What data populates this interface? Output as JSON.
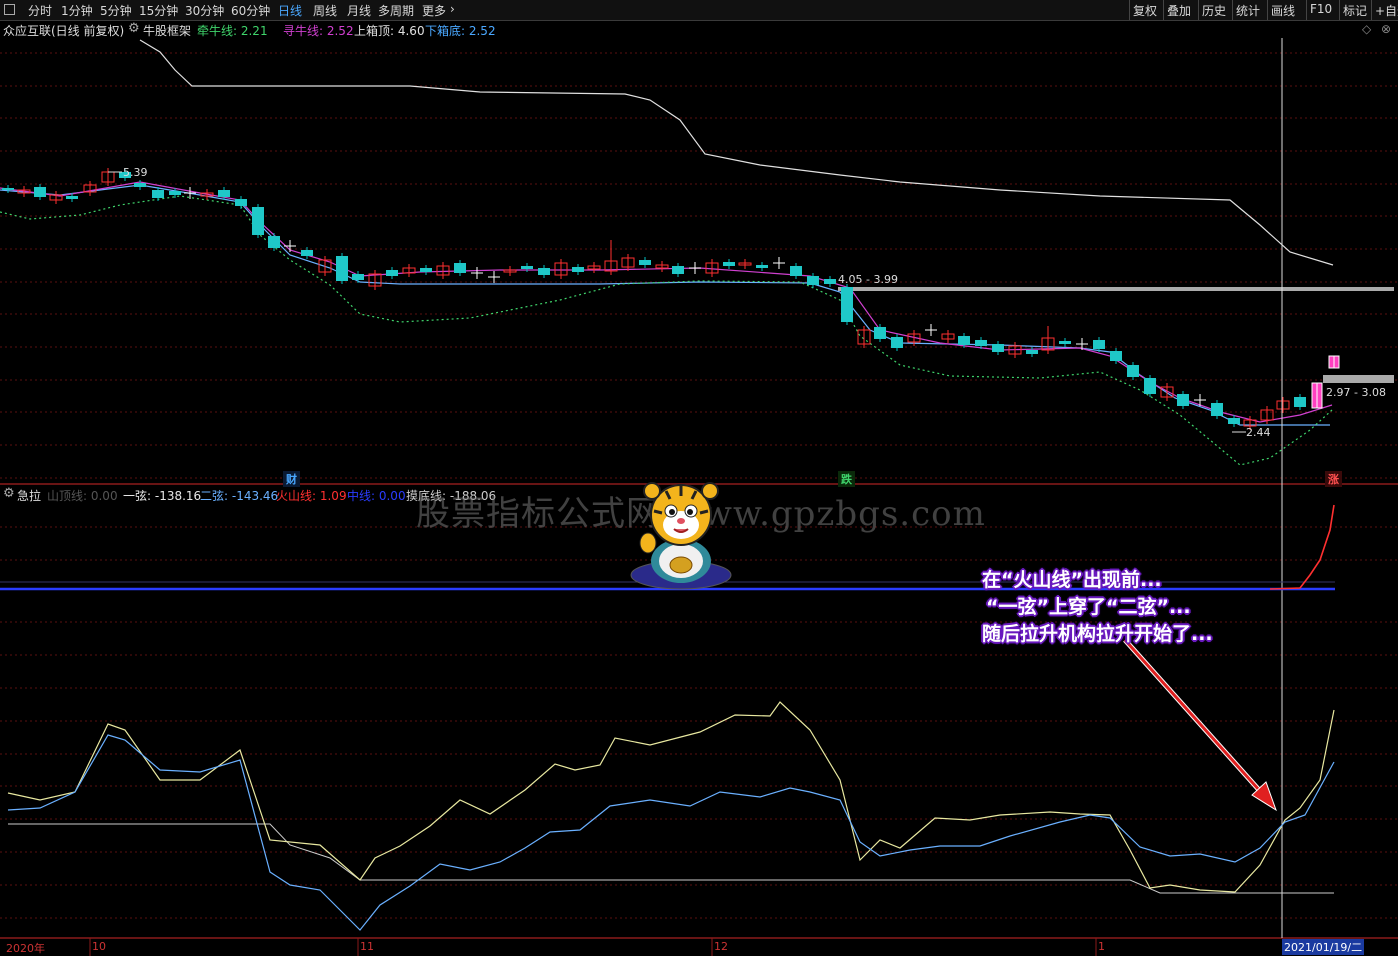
{
  "toolbar": {
    "left_items": [
      "分时",
      "1分钟",
      "5分钟",
      "15分钟",
      "30分钟",
      "60分钟",
      "日线",
      "周线",
      "月线",
      "多周期",
      "更多"
    ],
    "active_item": "日线",
    "right_items": [
      "复权",
      "叠加",
      "历史",
      "统计",
      "画线",
      "F10",
      "标记",
      "+自选"
    ]
  },
  "main_panel": {
    "stock_name": "众应互联(日线 前复权)",
    "indicator_name": "牛股框架",
    "lines": [
      {
        "label": "牵牛线: 2.21",
        "color": "#3fd46b"
      },
      {
        "label": "寻牛线: 2.52",
        "color": "#d040d0"
      },
      {
        "label": "上箱顶: 4.60",
        "color": "#e0e0e0"
      },
      {
        "label": "下箱底: 2.52",
        "color": "#4aa8ff"
      }
    ],
    "price_labels": {
      "high": "5.39",
      "box_mid": "4.05 - 3.99",
      "box_right": "2.97 - 3.08",
      "low": "2.44"
    },
    "event_markers": [
      {
        "text": "财",
        "color": "#4aa8ff"
      },
      {
        "text": "跌",
        "color": "#3fd46b"
      },
      {
        "text": "涨",
        "color": "#ff4040"
      }
    ]
  },
  "sub_panel": {
    "indicator_name": "急拉",
    "lines": [
      {
        "label": "山顶线: 0.00",
        "color": "#555555"
      },
      {
        "label": "一弦: -138.16",
        "color": "#e8e8e8"
      },
      {
        "label": "二弦: -143.46",
        "color": "#6ab0ff"
      },
      {
        "label": "火山线: 1.09",
        "color": "#ff3030"
      },
      {
        "label": "中线: 0.00",
        "color": "#2a3cff"
      },
      {
        "label": "摸底线: -188.06",
        "color": "#cccccc"
      }
    ]
  },
  "watermark": "股票指标公式网 www.gpzbgs.com",
  "annotation": {
    "lines": [
      "在“火山线”出现前...",
      "“一弦”上穿了“二弦”...",
      "随后拉升机构拉升开始了..."
    ]
  },
  "date_axis": {
    "labels": [
      "2020年",
      "10",
      "11",
      "12",
      "1"
    ],
    "cursor_date": "2021/01/19/二"
  },
  "chart_data": [
    {
      "type": "line",
      "title": "牛股框架",
      "series": [
        {
          "name": "上箱顶",
          "color": "#e0e0e0"
        },
        {
          "name": "寻牛线",
          "color": "#d040d0"
        },
        {
          "name": "下箱底",
          "color": "#4aa8ff"
        },
        {
          "name": "牵牛线",
          "color": "#3fd46b"
        }
      ],
      "annotations": [
        "5.39",
        "4.05 - 3.99",
        "2.97 - 3.08",
        "2.44"
      ]
    },
    {
      "type": "line",
      "title": "急拉",
      "series": [
        {
          "name": "一弦",
          "color": "#e8e880",
          "last": -138.16
        },
        {
          "name": "二弦",
          "color": "#6ab0ff",
          "last": -143.46
        },
        {
          "name": "火山线",
          "color": "#ff3030",
          "last": 1.09
        },
        {
          "name": "中线",
          "color": "#2a3cff",
          "last": 0.0
        },
        {
          "name": "摸底线",
          "color": "#cccccc",
          "last": -188.06
        }
      ]
    }
  ]
}
